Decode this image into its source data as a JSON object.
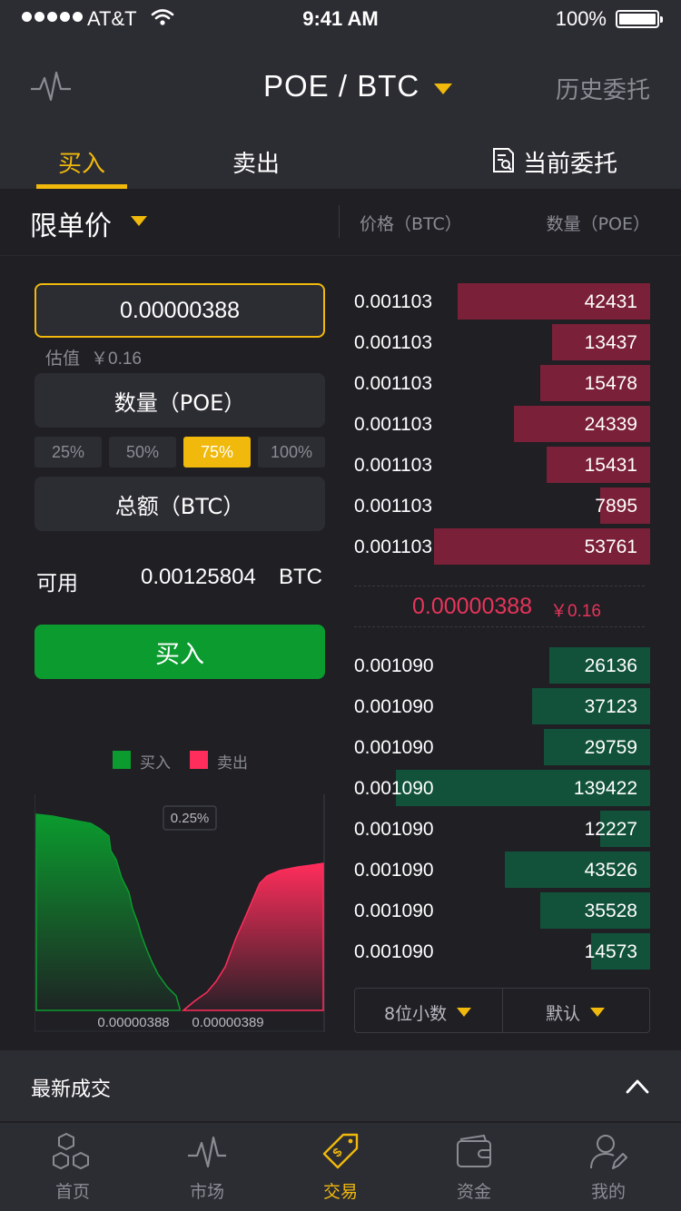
{
  "status_bar": {
    "carrier": "AT&T",
    "time": "9:41 AM",
    "battery": "100%"
  },
  "header": {
    "pair": "POE / BTC",
    "history": "历史委托"
  },
  "tabs": {
    "buy": "买入",
    "sell": "卖出",
    "orders": "当前委托"
  },
  "order_type": "限单价",
  "book_header": {
    "price": "价格（BTC）",
    "qty": "数量（POE）"
  },
  "form": {
    "price_value": "0.00000388",
    "estimate_label": "估值",
    "estimate_value": "￥0.16",
    "qty_placeholder": "数量（POE）",
    "total_placeholder": "总额（BTC）",
    "percents": [
      "25%",
      "50%",
      "75%",
      "100%"
    ],
    "active_percent": "75%",
    "available_label": "可用",
    "available_value": "0.00125804",
    "available_unit": "BTC",
    "buy_button": "买入"
  },
  "depth_chart": {
    "legend_buy": "买入",
    "legend_sell": "卖出",
    "tooltip": "0.25%",
    "x_left": "0.00000388",
    "x_right": "0.00000389",
    "buy_color": "#0b9b2e",
    "sell_color": "#ff2d5b"
  },
  "asks": [
    {
      "price": "0.001103",
      "qty": "42431",
      "fill": 0.65
    },
    {
      "price": "0.001103",
      "qty": "13437",
      "fill": 0.33
    },
    {
      "price": "0.001103",
      "qty": "15478",
      "fill": 0.37
    },
    {
      "price": "0.001103",
      "qty": "24339",
      "fill": 0.46
    },
    {
      "price": "0.001103",
      "qty": "15431",
      "fill": 0.35
    },
    {
      "price": "0.001103",
      "qty": "7895",
      "fill": 0.17
    },
    {
      "price": "0.001103",
      "qty": "53761",
      "fill": 0.73
    }
  ],
  "mid": {
    "price": "0.00000388",
    "cny": "￥0.16"
  },
  "bids": [
    {
      "price": "0.001090",
      "qty": "26136",
      "fill": 0.34
    },
    {
      "price": "0.001090",
      "qty": "37123",
      "fill": 0.4
    },
    {
      "price": "0.001090",
      "qty": "29759",
      "fill": 0.36
    },
    {
      "price": "0.001090",
      "qty": "139422",
      "fill": 0.86
    },
    {
      "price": "0.001090",
      "qty": "12227",
      "fill": 0.17
    },
    {
      "price": "0.001090",
      "qty": "43526",
      "fill": 0.49
    },
    {
      "price": "0.001090",
      "qty": "35528",
      "fill": 0.37
    },
    {
      "price": "0.001090",
      "qty": "14573",
      "fill": 0.2
    }
  ],
  "book_options": {
    "decimals": "8位小数",
    "mode": "默认"
  },
  "latest_trades": "最新成交",
  "tabbar": [
    {
      "label": "首页",
      "icon": "hexagons-icon"
    },
    {
      "label": "市场",
      "icon": "pulse-icon"
    },
    {
      "label": "交易",
      "icon": "tag-icon",
      "active": true
    },
    {
      "label": "资金",
      "icon": "wallet-icon"
    },
    {
      "label": "我的",
      "icon": "user-icon"
    }
  ],
  "colors": {
    "accent": "#f0b90b",
    "ask": "#7a2038",
    "bid": "#12523a",
    "mid": "#e8345a",
    "buy_button": "#0b9b2e"
  }
}
